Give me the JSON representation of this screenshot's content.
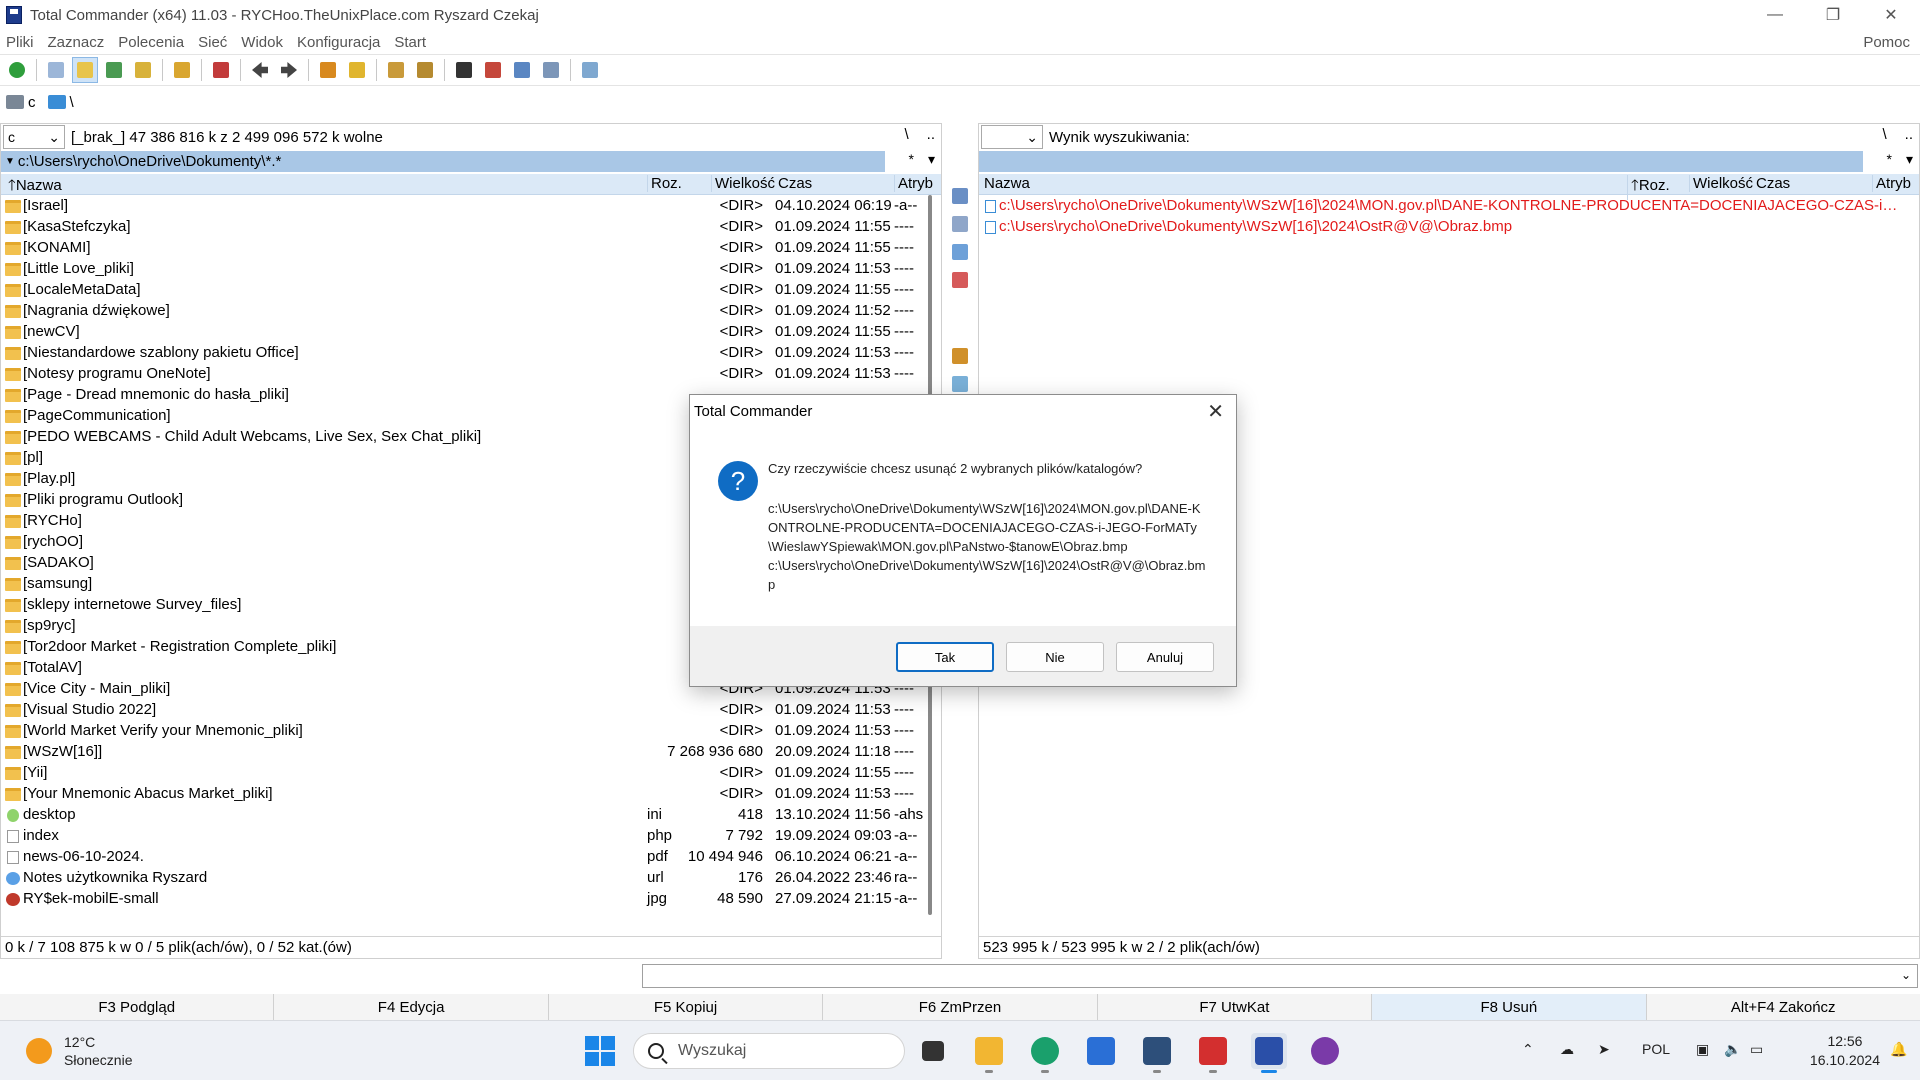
{
  "window": {
    "title": "Total Commander (x64) 11.03 - RYCHoo.TheUnixPlace.com Ryszard Czekaj"
  },
  "menu": {
    "items": [
      "Pliki",
      "Zaznacz",
      "Polecenia",
      "Sieć",
      "Widok",
      "Konfiguracja",
      "Start"
    ],
    "help": "Pomoc"
  },
  "drivebar": {
    "drive_c": "c",
    "net": "\\"
  },
  "left": {
    "drive": "c",
    "info": "[_brak_]  47 386 816 k z 2 499 096 572 k wolne",
    "root": "\\",
    "up": "..",
    "path": "c:\\Users\\rycho\\OneDrive\\Dokumenty\\*.*",
    "filter": "*",
    "hist": "▾",
    "headers": {
      "name": "Nazwa",
      "ext": "Roz.",
      "size": "Wielkość",
      "time": "Czas",
      "attr": "Atryb"
    },
    "rows": [
      {
        "name": "[Israel]",
        "ext": "",
        "size": "<DIR>",
        "time": "04.10.2024 06:19",
        "attr": "-a--",
        "icon": "folder"
      },
      {
        "name": "[KasaStefczyka]",
        "ext": "",
        "size": "<DIR>",
        "time": "01.09.2024 11:55",
        "attr": "----",
        "icon": "folder"
      },
      {
        "name": "[KONAMI]",
        "ext": "",
        "size": "<DIR>",
        "time": "01.09.2024 11:55",
        "attr": "----",
        "icon": "folder"
      },
      {
        "name": "[Little Love_pliki]",
        "ext": "",
        "size": "<DIR>",
        "time": "01.09.2024 11:53",
        "attr": "----",
        "icon": "folder"
      },
      {
        "name": "[LocaleMetaData]",
        "ext": "",
        "size": "<DIR>",
        "time": "01.09.2024 11:55",
        "attr": "----",
        "icon": "folder"
      },
      {
        "name": "[Nagrania dźwiękowe]",
        "ext": "",
        "size": "<DIR>",
        "time": "01.09.2024 11:52",
        "attr": "----",
        "icon": "folder"
      },
      {
        "name": "[newCV]",
        "ext": "",
        "size": "<DIR>",
        "time": "01.09.2024 11:55",
        "attr": "----",
        "icon": "folder"
      },
      {
        "name": "[Niestandardowe szablony pakietu Office]",
        "ext": "",
        "size": "<DIR>",
        "time": "01.09.2024 11:53",
        "attr": "----",
        "icon": "folder"
      },
      {
        "name": "[Notesy programu OneNote]",
        "ext": "",
        "size": "<DIR>",
        "time": "01.09.2024 11:53",
        "attr": "----",
        "icon": "folder"
      },
      {
        "name": "[Page - Dread mnemonic do hasła_pliki]",
        "ext": "",
        "size": "",
        "time": "",
        "attr": "",
        "icon": "folder"
      },
      {
        "name": "[PageCommunication]",
        "ext": "",
        "size": "",
        "time": "",
        "attr": "",
        "icon": "folder"
      },
      {
        "name": "[PEDO WEBCAMS - Child Adult Webcams, Live Sex, Sex Chat_pliki]",
        "ext": "",
        "size": "",
        "time": "",
        "attr": "",
        "icon": "folder"
      },
      {
        "name": "[pl]",
        "ext": "",
        "size": "",
        "time": "",
        "attr": "",
        "icon": "folder"
      },
      {
        "name": "[Play.pl]",
        "ext": "",
        "size": "",
        "time": "",
        "attr": "",
        "icon": "folder"
      },
      {
        "name": "[Pliki programu Outlook]",
        "ext": "",
        "size": "",
        "time": "",
        "attr": "",
        "icon": "folder"
      },
      {
        "name": "[RYCHo]",
        "ext": "",
        "size": "",
        "time": "",
        "attr": "",
        "icon": "folder"
      },
      {
        "name": "[rychOO]",
        "ext": "",
        "size": "",
        "time": "",
        "attr": "",
        "icon": "folder"
      },
      {
        "name": "[SADAKO]",
        "ext": "",
        "size": "",
        "time": "",
        "attr": "",
        "icon": "folder"
      },
      {
        "name": "[samsung]",
        "ext": "",
        "size": "",
        "time": "",
        "attr": "",
        "icon": "folder"
      },
      {
        "name": "[sklepy internetowe Survey_files]",
        "ext": "",
        "size": "",
        "time": "",
        "attr": "",
        "icon": "folder"
      },
      {
        "name": "[sp9ryc]",
        "ext": "",
        "size": "",
        "time": "",
        "attr": "",
        "icon": "folder"
      },
      {
        "name": "[Tor2door Market - Registration Complete_pliki]",
        "ext": "",
        "size": "",
        "time": "",
        "attr": "",
        "icon": "folder"
      },
      {
        "name": "[TotalAV]",
        "ext": "",
        "size": "",
        "time": "",
        "attr": "",
        "icon": "folder"
      },
      {
        "name": "[Vice City - Main_pliki]",
        "ext": "",
        "size": "<DIR>",
        "time": "01.09.2024 11:53",
        "attr": "----",
        "icon": "folder"
      },
      {
        "name": "[Visual Studio 2022]",
        "ext": "",
        "size": "<DIR>",
        "time": "01.09.2024 11:53",
        "attr": "----",
        "icon": "folder"
      },
      {
        "name": "[World Market Verify your Mnemonic_pliki]",
        "ext": "",
        "size": "<DIR>",
        "time": "01.09.2024 11:53",
        "attr": "----",
        "icon": "folder"
      },
      {
        "name": "[WSzW[16]]",
        "ext": "",
        "size": "7 268 936 680",
        "time": "20.09.2024 11:18",
        "attr": "----",
        "icon": "folder"
      },
      {
        "name": "[Yii]",
        "ext": "",
        "size": "<DIR>",
        "time": "01.09.2024 11:55",
        "attr": "----",
        "icon": "folder"
      },
      {
        "name": "[Your Mnemonic Abacus Market_pliki]",
        "ext": "",
        "size": "<DIR>",
        "time": "01.09.2024 11:53",
        "attr": "----",
        "icon": "folder"
      },
      {
        "name": "desktop",
        "ext": "ini",
        "size": "418",
        "time": "13.10.2024 11:56",
        "attr": "-ahs",
        "icon": "file-ini"
      },
      {
        "name": "index",
        "ext": "php",
        "size": "7 792",
        "time": "19.09.2024 09:03",
        "attr": "-a--",
        "icon": "file"
      },
      {
        "name": "news-06-10-2024.",
        "ext": "pdf",
        "size": "10 494 946",
        "time": "06.10.2024 06:21",
        "attr": "-a--",
        "icon": "file"
      },
      {
        "name": "Notes użytkownika Ryszard",
        "ext": "url",
        "size": "176",
        "time": "26.04.2022 23:46",
        "attr": "ra--",
        "icon": "file-url"
      },
      {
        "name": "RY$ek-mobilE-small",
        "ext": "jpg",
        "size": "48 590",
        "time": "27.09.2024 21:15",
        "attr": "-a--",
        "icon": "file-jpg"
      }
    ],
    "status": "0 k / 7 108 875 k w 0 / 5 plik(ach/ów), 0 / 52 kat.(ów)"
  },
  "right": {
    "drive": "",
    "info": "Wynik wyszukiwania:",
    "root": "\\",
    "up": "..",
    "path": "",
    "filter": "*",
    "hist": "▾",
    "headers": {
      "name": "Nazwa",
      "ext": "Roz.",
      "size": "Wielkość",
      "time": "Czas",
      "attr": "Atryb"
    },
    "rows": [
      {
        "name": "c:\\Users\\rycho\\OneDrive\\Dokumenty\\WSzW[16]\\2024\\MON.gov.pl\\DANE-KONTROLNE-PRODUCENTA=DOCENIAJACEGO-CZAS-i-JEGO-F..."
      },
      {
        "name": "c:\\Users\\rycho\\OneDrive\\Dokumenty\\WSzW[16]\\2024\\OstR@V@\\Obraz.bmp"
      }
    ],
    "status": "523 995 k / 523 995 k w 2 / 2 plik(ach/ów)"
  },
  "fkeys": [
    "F3 Podgląd",
    "F4 Edycja",
    "F5 Kopiuj",
    "F6 ZmPrzen",
    "F7 UtwKat",
    "F8 Usuń",
    "Alt+F4 Zakończ"
  ],
  "dialog": {
    "title": "Total Commander",
    "question": "Czy rzeczywiście chcesz usunąć 2 wybranych plików/katalogów?",
    "file1": "c:\\Users\\rycho\\OneDrive\\Dokumenty\\WSzW[16]\\2024\\MON.gov.pl\\DANE-KONTROLNE-PRODUCENTA=DOCENIAJACEGO-CZAS-i-JEGO-ForMATy\\WieslawYSpiewak\\MON.gov.pl\\PaNstwo-$tanowE\\Obraz.bmp",
    "file2": "c:\\Users\\rycho\\OneDrive\\Dokumenty\\WSzW[16]\\2024\\OstR@V@\\Obraz.bmp",
    "yes": "Tak",
    "no": "Nie",
    "cancel": "Anuluj"
  },
  "taskbar": {
    "temp": "12°C",
    "weather": "Słonecznie",
    "search": "Wyszukaj",
    "lang": "POL",
    "time": "12:56",
    "date": "16.10.2024"
  }
}
